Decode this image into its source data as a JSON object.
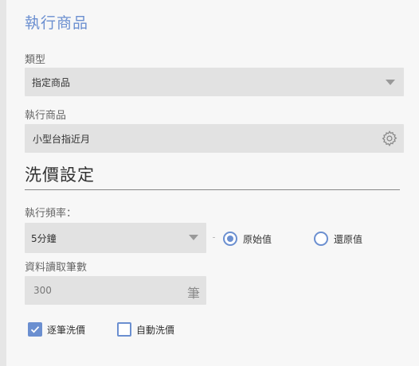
{
  "section_title": "執行商品",
  "type_field": {
    "label": "類型",
    "value": "指定商品"
  },
  "product_field": {
    "label": "執行商品",
    "value": "小型台指近月"
  },
  "wash": {
    "title": "洗價設定",
    "frequency_label": "執行頻率：",
    "frequency_value": "5分鐘",
    "radio_original": "原始值",
    "radio_restore": "還原值",
    "radio_selected": "原始值",
    "read_count_label": "資料讀取筆數",
    "read_count_value": "300",
    "read_count_unit": "筆",
    "checkbox_each": {
      "label": "逐筆洗價",
      "checked": true
    },
    "checkbox_auto": {
      "label": "自動洗價",
      "checked": false
    }
  },
  "colors": {
    "accent": "#6b8fd0",
    "field_bg": "#e2e2e2",
    "page_bg": "#f7f7f7"
  },
  "icons": {
    "dropdown": "caret-down",
    "settings": "gear-icon",
    "check": "check-icon"
  }
}
